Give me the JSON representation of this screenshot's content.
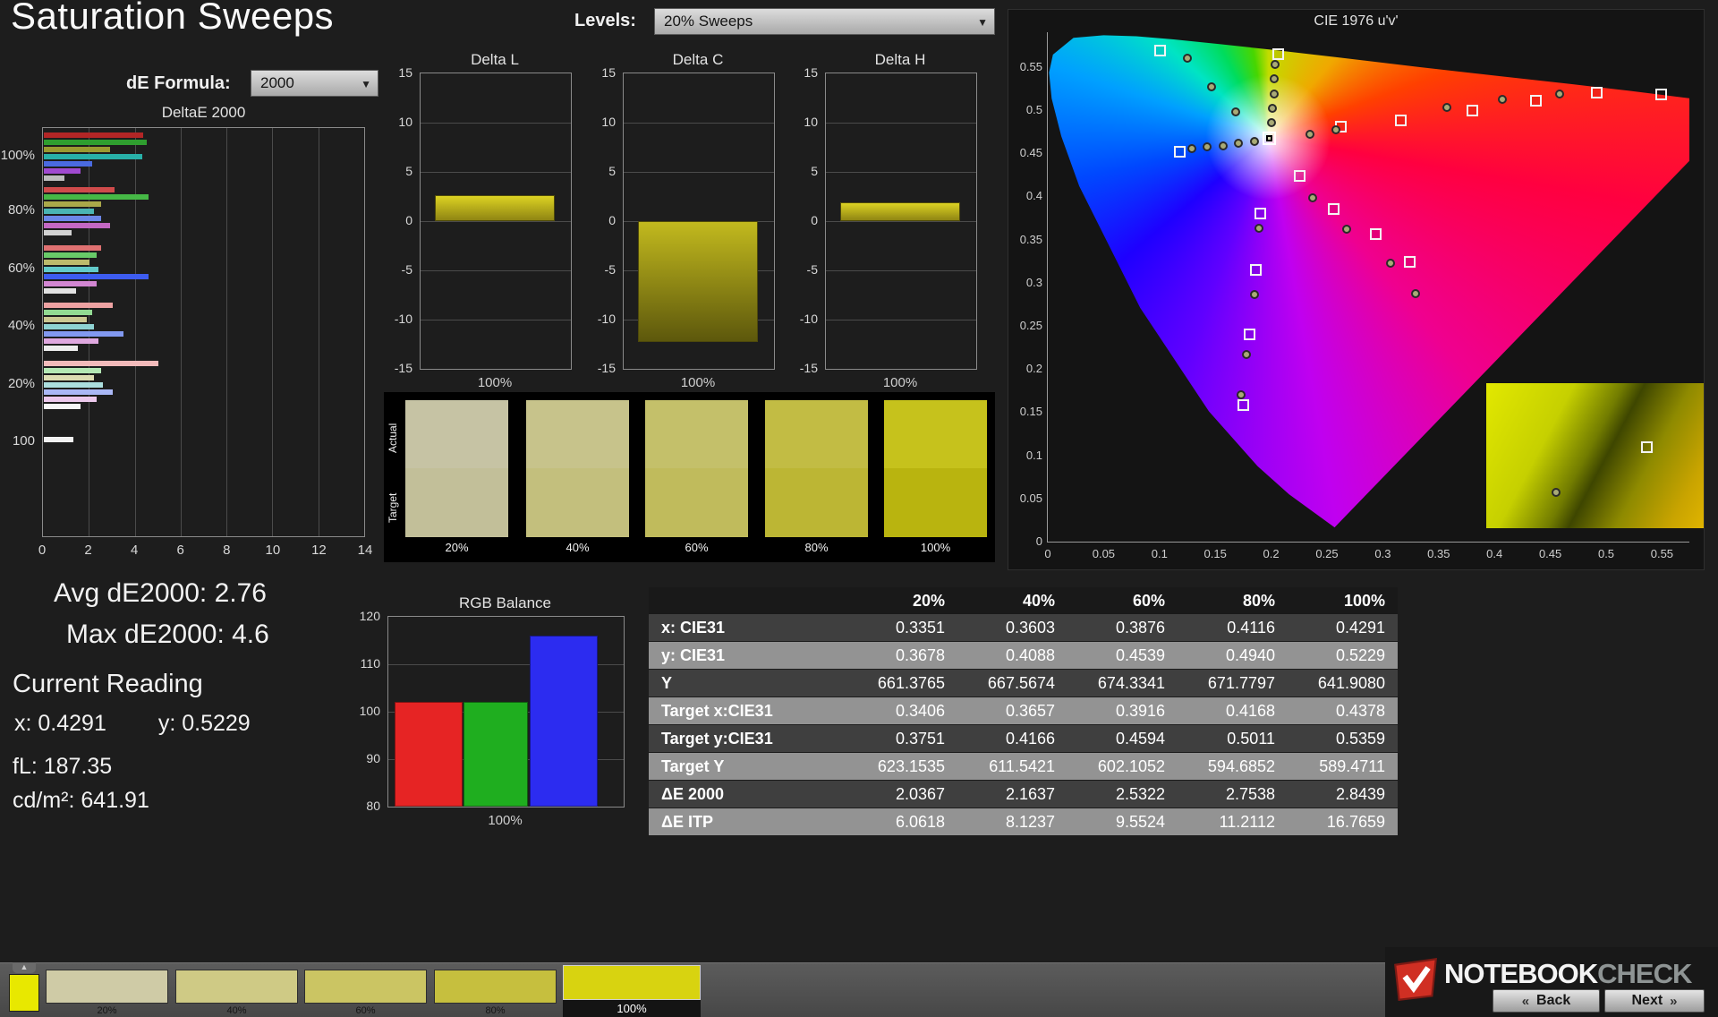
{
  "header": {
    "title": "Saturation Sweeps",
    "levels_label": "Levels:",
    "levels_value": "20% Sweeps",
    "formula_label": "dE Formula:",
    "formula_value": "2000"
  },
  "icons": {
    "dropdown": "▼",
    "back": "«",
    "next": "»",
    "collapse": "▲"
  },
  "readings": {
    "avg": "Avg dE2000: 2.76",
    "max": "Max dE2000: 4.6",
    "heading": "Current Reading",
    "x": "x: 0.4291",
    "y": "y: 0.5229",
    "fl": "fL: 187.35",
    "luminance": "cd/m²: 641.91"
  },
  "saturation_swatches": {
    "actual_label": "Actual",
    "target_label": "Target",
    "items": [
      {
        "label": "20%",
        "actual": "#c6c3a4",
        "target": "#c2bf99"
      },
      {
        "label": "40%",
        "actual": "#c7c38b",
        "target": "#c3bf7d"
      },
      {
        "label": "60%",
        "actual": "#c4c06a",
        "target": "#c0bb5c"
      },
      {
        "label": "80%",
        "actual": "#c2bc44",
        "target": "#bcb634"
      },
      {
        "label": "100%",
        "actual": "#c6c21c",
        "target": "#b9b40f"
      }
    ]
  },
  "bottom_bar": {
    "active_color": "#e8e800",
    "patches": [
      {
        "label": "20%",
        "color": "#cfcba6",
        "selected": false
      },
      {
        "label": "40%",
        "color": "#cfca85",
        "selected": false
      },
      {
        "label": "60%",
        "color": "#cbc563",
        "selected": false
      },
      {
        "label": "80%",
        "color": "#c6bf3e",
        "selected": false
      },
      {
        "label": "100%",
        "color": "#d8d310",
        "selected": true
      }
    ],
    "back_label": "Back",
    "next_label": "Next",
    "logo_text_1": "NOTEBOOK",
    "logo_text_2": "CHECK"
  },
  "chart_data": [
    {
      "id": "deltae_sweep",
      "type": "bar",
      "title": "DeltaE 2000",
      "xlim": [
        0,
        14
      ],
      "x_ticks": [
        "0",
        "2",
        "4",
        "6",
        "8",
        "10",
        "12",
        "14"
      ],
      "groups": [
        {
          "label": "100%",
          "bars": [
            {
              "c": "#b22626",
              "v": 4.35
            },
            {
              "c": "#2f9e2f",
              "v": 4.5
            },
            {
              "c": "#9a9a30",
              "v": 2.9
            },
            {
              "c": "#28b0a8",
              "v": 4.3
            },
            {
              "c": "#4a6ae0",
              "v": 2.1
            },
            {
              "c": "#a04ad0",
              "v": 1.6
            },
            {
              "c": "#bdbdbd",
              "v": 0.9
            }
          ]
        },
        {
          "label": "80%",
          "bars": [
            {
              "c": "#cf4b4b",
              "v": 3.1
            },
            {
              "c": "#46b846",
              "v": 4.6
            },
            {
              "c": "#aaa84a",
              "v": 2.5
            },
            {
              "c": "#4ab4b4",
              "v": 2.2
            },
            {
              "c": "#6c86e8",
              "v": 2.5
            },
            {
              "c": "#c468c4",
              "v": 2.9
            },
            {
              "c": "#d2d2d2",
              "v": 1.2
            }
          ]
        },
        {
          "label": "60%",
          "bars": [
            {
              "c": "#df7171",
              "v": 2.5
            },
            {
              "c": "#68ca68",
              "v": 2.3
            },
            {
              "c": "#bcba6c",
              "v": 2.0
            },
            {
              "c": "#62caca",
              "v": 2.4
            },
            {
              "c": "#3d5cf0",
              "v": 4.6
            },
            {
              "c": "#d286d2",
              "v": 2.3
            },
            {
              "c": "#e2e2e2",
              "v": 1.4
            }
          ]
        },
        {
          "label": "40%",
          "bars": [
            {
              "c": "#eda2a2",
              "v": 3.0
            },
            {
              "c": "#92da92",
              "v": 2.1
            },
            {
              "c": "#cbc892",
              "v": 1.9
            },
            {
              "c": "#8ed2d2",
              "v": 2.2
            },
            {
              "c": "#8299f0",
              "v": 3.5
            },
            {
              "c": "#dfa8df",
              "v": 2.4
            },
            {
              "c": "#ededed",
              "v": 1.5
            }
          ]
        },
        {
          "label": "20%",
          "bars": [
            {
              "c": "#f2baba",
              "v": 5.0
            },
            {
              "c": "#b4e8b4",
              "v": 2.5
            },
            {
              "c": "#dcdcb2",
              "v": 2.2
            },
            {
              "c": "#abdede",
              "v": 2.6
            },
            {
              "c": "#aab8f6",
              "v": 3.0
            },
            {
              "c": "#ecc9ec",
              "v": 2.3
            },
            {
              "c": "#f6f6f6",
              "v": 1.6
            }
          ]
        },
        {
          "label": "100",
          "bars": [
            {
              "c": "#f2f2f2",
              "v": 1.3
            }
          ]
        }
      ]
    },
    {
      "id": "delta_l",
      "type": "bar",
      "title": "Delta L",
      "xlabel": "100%",
      "value": 2.6,
      "ylim": [
        -15,
        15
      ],
      "y_ticks": [
        "15",
        "10",
        "5",
        "0",
        "-5",
        "-10",
        "-15"
      ]
    },
    {
      "id": "delta_c",
      "type": "bar",
      "title": "Delta C",
      "xlabel": "100%",
      "value": -12.3,
      "ylim": [
        -15,
        15
      ],
      "y_ticks": [
        "15",
        "10",
        "5",
        "0",
        "-5",
        "-10",
        "-15"
      ]
    },
    {
      "id": "delta_h",
      "type": "bar",
      "title": "Delta H",
      "xlabel": "100%",
      "value": 1.9,
      "ylim": [
        -15,
        15
      ],
      "y_ticks": [
        "15",
        "10",
        "5",
        "0",
        "-5",
        "-10",
        "-15"
      ]
    },
    {
      "id": "rgb_balance",
      "type": "bar",
      "title": "RGB Balance",
      "xlabel": "100%",
      "categories": [
        "Red",
        "Green",
        "Blue"
      ],
      "values": [
        102,
        102,
        116
      ],
      "colors": [
        "#e62424",
        "#1fae1f",
        "#2c2cf0"
      ],
      "ylim": [
        80,
        120
      ],
      "y_ticks": [
        "120",
        "110",
        "100",
        "90",
        "80"
      ]
    },
    {
      "id": "cie",
      "type": "scatter",
      "title": "CIE 1976 u'v'",
      "xlim": [
        0,
        0.575
      ],
      "ylim": [
        0,
        0.59
      ],
      "x_ticks": [
        "0",
        "0.05",
        "0.1",
        "0.15",
        "0.2",
        "0.25",
        "0.3",
        "0.35",
        "0.4",
        "0.45",
        "0.5",
        "0.55"
      ],
      "y_ticks": [
        "0",
        "0.05",
        "0.1",
        "0.15",
        "0.2",
        "0.25",
        "0.3",
        "0.35",
        "0.4",
        "0.45",
        "0.5",
        "0.55"
      ],
      "white_point": [
        0.198,
        0.468
      ],
      "squares": [
        [
          0.1,
          0.57
        ],
        [
          0.206,
          0.565
        ],
        [
          0.262,
          0.481
        ],
        [
          0.316,
          0.489
        ],
        [
          0.38,
          0.5
        ],
        [
          0.437,
          0.511
        ],
        [
          0.491,
          0.521
        ],
        [
          0.549,
          0.519
        ],
        [
          0.225,
          0.424
        ],
        [
          0.256,
          0.386
        ],
        [
          0.293,
          0.357
        ],
        [
          0.324,
          0.325
        ],
        [
          0.19,
          0.381
        ],
        [
          0.186,
          0.315
        ],
        [
          0.18,
          0.241
        ],
        [
          0.175,
          0.159
        ],
        [
          0.118,
          0.452
        ]
      ],
      "circles": [
        [
          0.125,
          0.56
        ],
        [
          0.147,
          0.527
        ],
        [
          0.168,
          0.498
        ],
        [
          0.2035,
          0.553
        ],
        [
          0.203,
          0.536
        ],
        [
          0.2025,
          0.519
        ],
        [
          0.2015,
          0.502
        ],
        [
          0.2005,
          0.485
        ],
        [
          0.129,
          0.4555
        ],
        [
          0.143,
          0.457
        ],
        [
          0.157,
          0.459
        ],
        [
          0.171,
          0.462
        ],
        [
          0.185,
          0.464
        ],
        [
          0.235,
          0.472
        ],
        [
          0.258,
          0.477
        ],
        [
          0.357,
          0.503
        ],
        [
          0.407,
          0.512
        ],
        [
          0.458,
          0.519
        ],
        [
          0.237,
          0.398
        ],
        [
          0.268,
          0.362
        ],
        [
          0.307,
          0.323
        ],
        [
          0.329,
          0.287
        ],
        [
          0.189,
          0.363
        ],
        [
          0.185,
          0.286
        ],
        [
          0.178,
          0.217
        ],
        [
          0.173,
          0.17
        ]
      ]
    },
    {
      "id": "measurement_table",
      "type": "table",
      "headers": [
        "20%",
        "40%",
        "60%",
        "80%",
        "100%"
      ],
      "rows": [
        {
          "label": "x: CIE31",
          "values": [
            "0.3351",
            "0.3603",
            "0.3876",
            "0.4116",
            "0.4291"
          ]
        },
        {
          "label": "y: CIE31",
          "values": [
            "0.3678",
            "0.4088",
            "0.4539",
            "0.4940",
            "0.5229"
          ]
        },
        {
          "label": "Y",
          "values": [
            "661.3765",
            "667.5674",
            "674.3341",
            "671.7797",
            "641.9080"
          ]
        },
        {
          "label": "Target x:CIE31",
          "values": [
            "0.3406",
            "0.3657",
            "0.3916",
            "0.4168",
            "0.4378"
          ]
        },
        {
          "label": "Target y:CIE31",
          "values": [
            "0.3751",
            "0.4166",
            "0.4594",
            "0.5011",
            "0.5359"
          ]
        },
        {
          "label": "Target Y",
          "values": [
            "623.1535",
            "611.5421",
            "602.1052",
            "594.6852",
            "589.4711"
          ]
        },
        {
          "label": "ΔE 2000",
          "values": [
            "2.0367",
            "2.1637",
            "2.5322",
            "2.7538",
            "2.8439"
          ]
        },
        {
          "label": "ΔE ITP",
          "values": [
            "6.0618",
            "8.1237",
            "9.5524",
            "11.2112",
            "16.7659"
          ]
        }
      ]
    }
  ]
}
